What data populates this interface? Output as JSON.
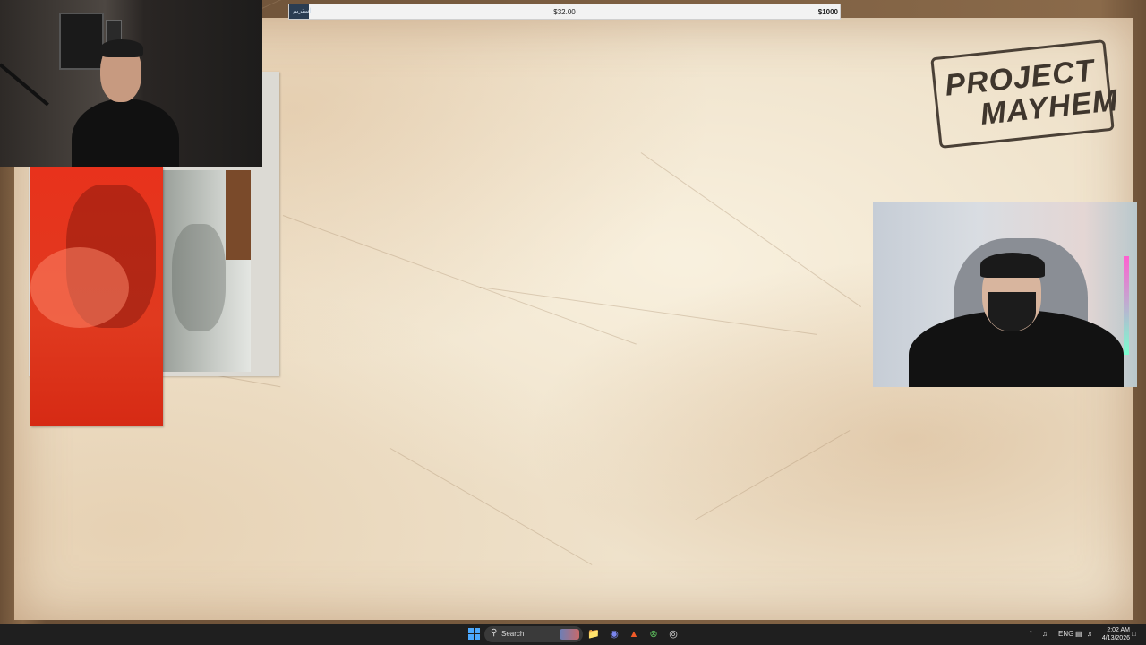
{
  "goal_bar": {
    "fill_label": "استریم",
    "progress_fraction": 0.032,
    "current_amount": "$32.00",
    "target_amount": "$1000"
  },
  "logo": {
    "line1": "PROJECT",
    "line2": "MAYHEM"
  },
  "taskbar": {
    "search_label": "Search",
    "apps": [
      "file-explorer-icon",
      "discord-icon",
      "brave-browser-icon",
      "xbox-icon",
      "obs-icon"
    ],
    "tray": {
      "language": "ENG",
      "time": "2:02 AM",
      "date": "4/13/2026"
    }
  },
  "colors": {
    "parchment": "#efe2cb",
    "goal_fill": "#2b3d52",
    "taskbar": "#1f1f1f",
    "windows_accent": "#4ca9ff",
    "poster_red": "#e8321c"
  }
}
